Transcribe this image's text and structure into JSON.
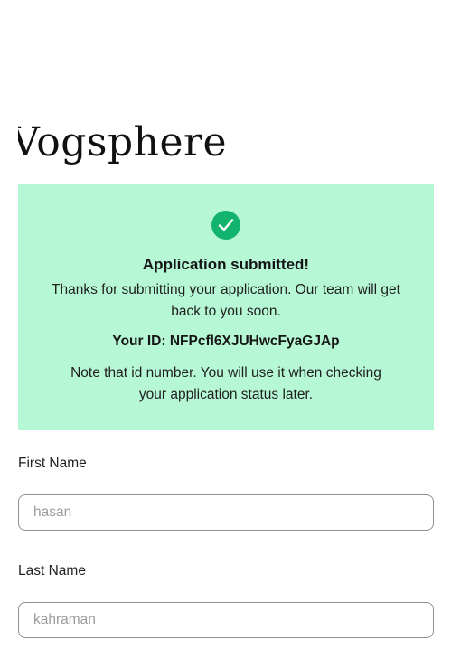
{
  "brand": {
    "logo_text": "Vogsphere"
  },
  "success": {
    "icon": "check-circle-icon",
    "title": "Application submitted!",
    "message": "Thanks for submitting your application. Our team will get back to you soon.",
    "id_label": "Your ID:",
    "id_value": "NFPcfl6XJUHwcFyaGJAp",
    "id_line": "Your ID: NFPcfl6XJUHwcFyaGJAp",
    "note": "Note that id number. You will use it when checking your application status later.",
    "background_color": "#b6f7d6",
    "icon_color": "#12b36d"
  },
  "form": {
    "first_name": {
      "label": "First Name",
      "value": "",
      "placeholder": "hasan"
    },
    "last_name": {
      "label": "Last Name",
      "value": "",
      "placeholder": "kahraman"
    }
  }
}
